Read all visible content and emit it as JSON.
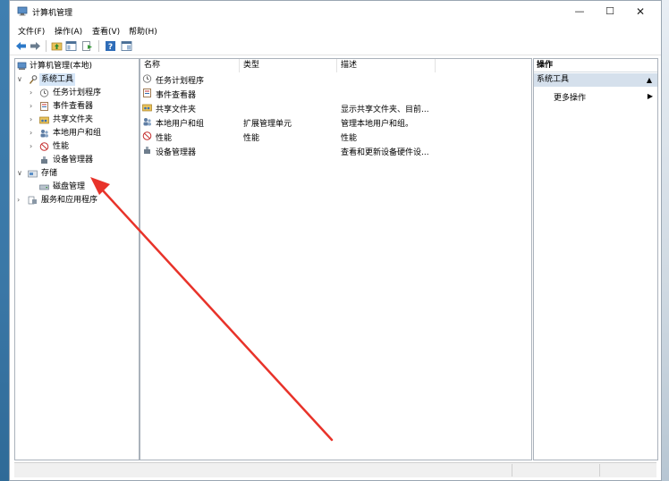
{
  "window": {
    "title": "计算机管理"
  },
  "menubar": [
    "文件(F)",
    "操作(A)",
    "查看(V)",
    "帮助(H)"
  ],
  "tree": {
    "root": "计算机管理(本地)",
    "system_tools": "系统工具",
    "task_scheduler": "任务计划程序",
    "event_viewer": "事件查看器",
    "shared_folders": "共享文件夹",
    "local_users": "本地用户和组",
    "performance": "性能",
    "device_manager": "设备管理器",
    "storage": "存储",
    "disk_management": "磁盘管理",
    "services_apps": "服务和应用程序"
  },
  "list": {
    "columns": {
      "name": "名称",
      "type": "类型",
      "description": "描述"
    },
    "rows": [
      {
        "name": "任务计划程序",
        "type": "",
        "description": ""
      },
      {
        "name": "事件查看器",
        "type": "",
        "description": ""
      },
      {
        "name": "共享文件夹",
        "type": "",
        "description": "显示共享文件夹、目前..."
      },
      {
        "name": "本地用户和组",
        "type": "扩展管理单元",
        "description": "管理本地用户和组。"
      },
      {
        "name": "性能",
        "type": "性能",
        "description": "性能"
      },
      {
        "name": "设备管理器",
        "type": "",
        "description": "查看和更新设备硬件设..."
      }
    ]
  },
  "actions": {
    "header": "操作",
    "section": "系统工具",
    "more_actions": "更多操作"
  },
  "colors": {
    "selection": "#d6e6f7",
    "action_section": "#d5e0ec",
    "annotation_arrow": "#e8332a"
  }
}
